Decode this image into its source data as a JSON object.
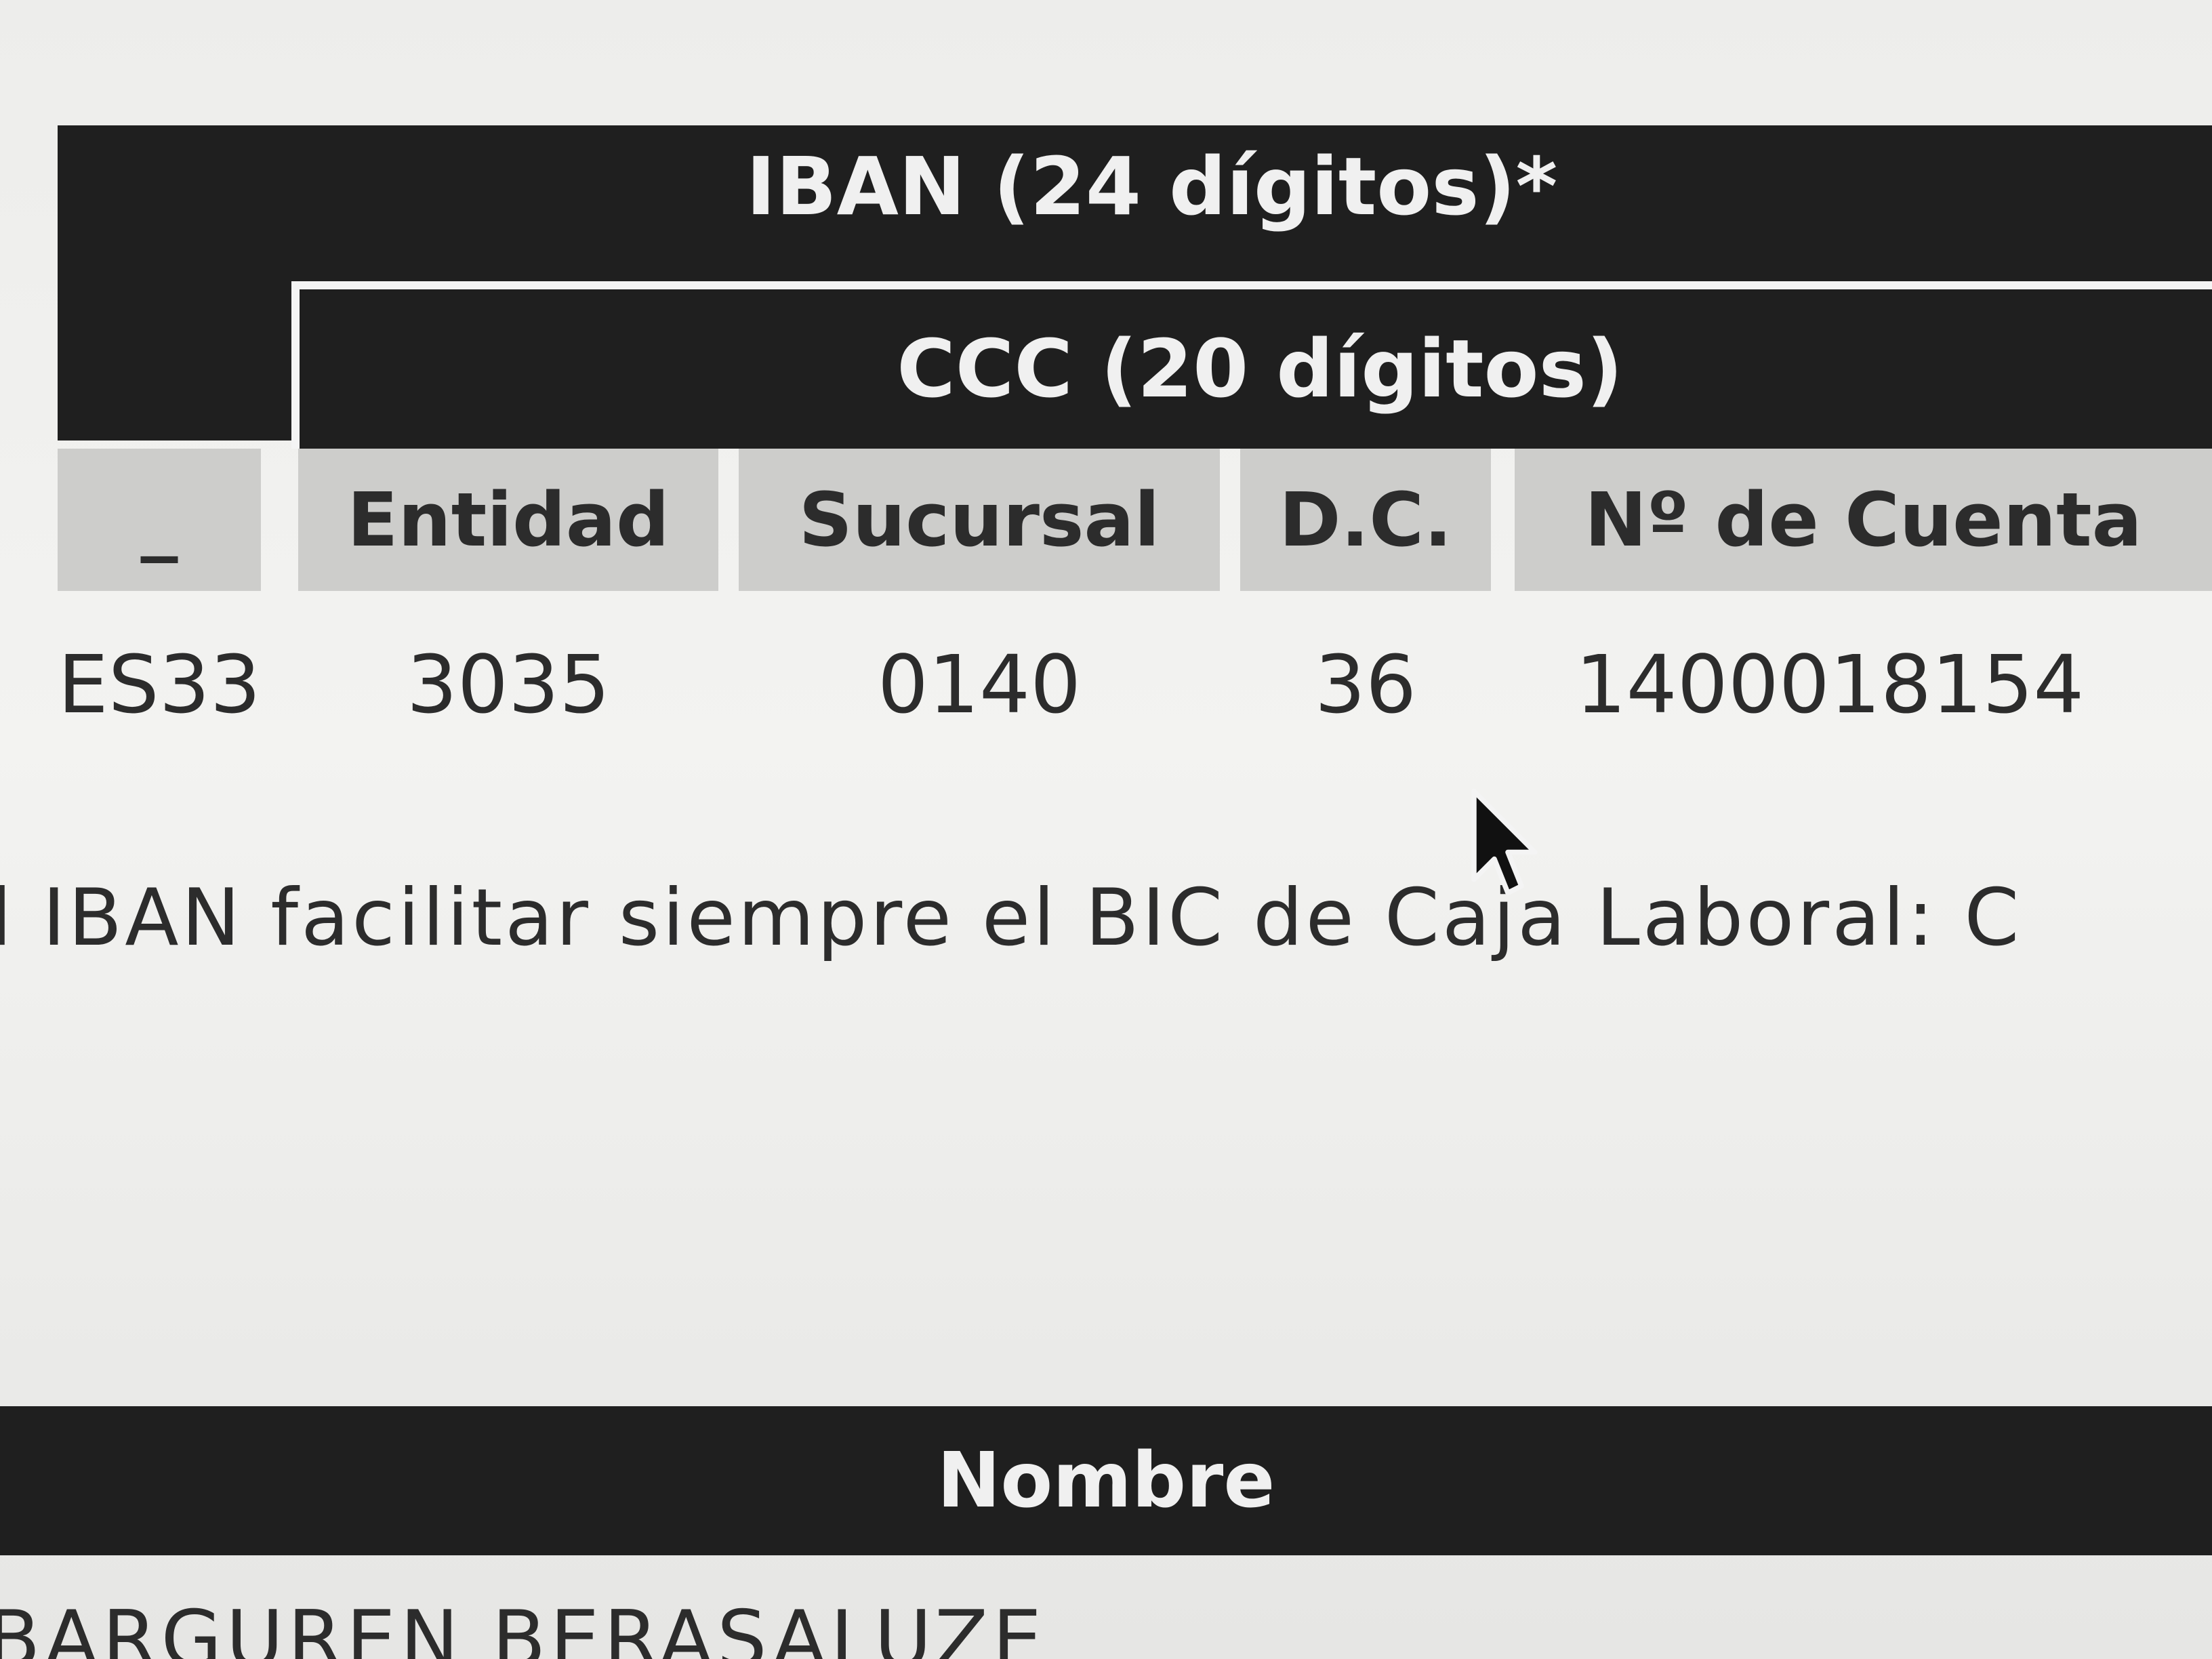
{
  "account_table": {
    "iban_header": "IBAN (24 dígitos)*",
    "ccc_header": "CCC (20 dígitos)",
    "columns": [
      "_",
      "Entidad",
      "Sucursal",
      "D.C.",
      "Nº de Cuenta"
    ],
    "row": [
      "ES33",
      "3035",
      "0140",
      "36",
      "1400018154"
    ]
  },
  "bic_note": "el IBAN facilitar siempre el BIC de Caja Laboral: C",
  "holder": {
    "header": "Nombre",
    "value": "BARGUREN BERASALUZE"
  },
  "icons": {
    "cursor": "mouse-pointer-icon"
  },
  "colors": {
    "header_background": "#1f1f1f",
    "header_text": "#f0f0f0",
    "column_header_background": "#cdcdcb",
    "page_background": "#ededeb"
  }
}
